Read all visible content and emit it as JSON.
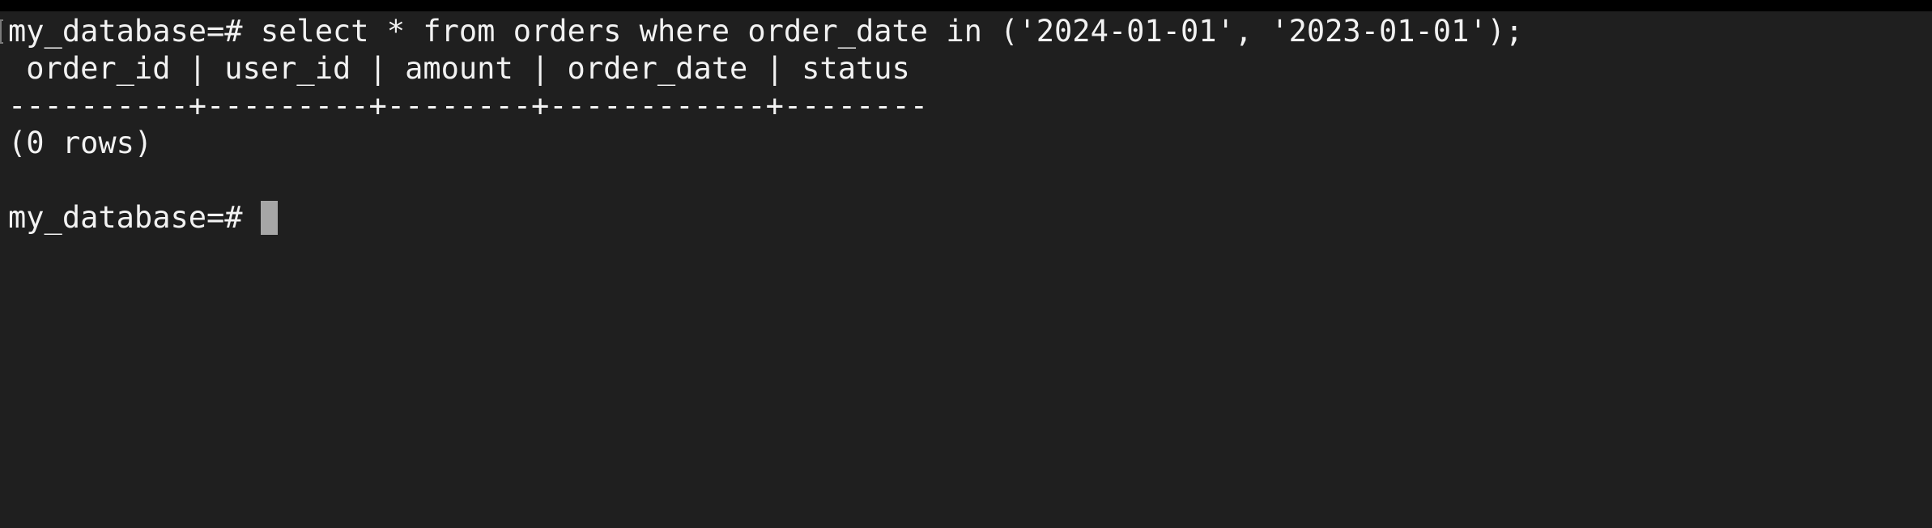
{
  "terminal": {
    "prompt": "my_database=#",
    "command": "select * from orders where order_date in ('2024-01-01', '2023-01-01');",
    "header_row": " order_id | user_id | amount | order_date | status",
    "separator_row": "----------+---------+--------+------------+--------",
    "result_summary": "(0 rows)",
    "blank_line": "",
    "current_prompt": "my_database=#",
    "current_input": ""
  },
  "colors": {
    "background": "#1f1f1f",
    "text": "#f2f2f2",
    "cursor": "#a6a6a6",
    "top_strip": "#000000"
  }
}
